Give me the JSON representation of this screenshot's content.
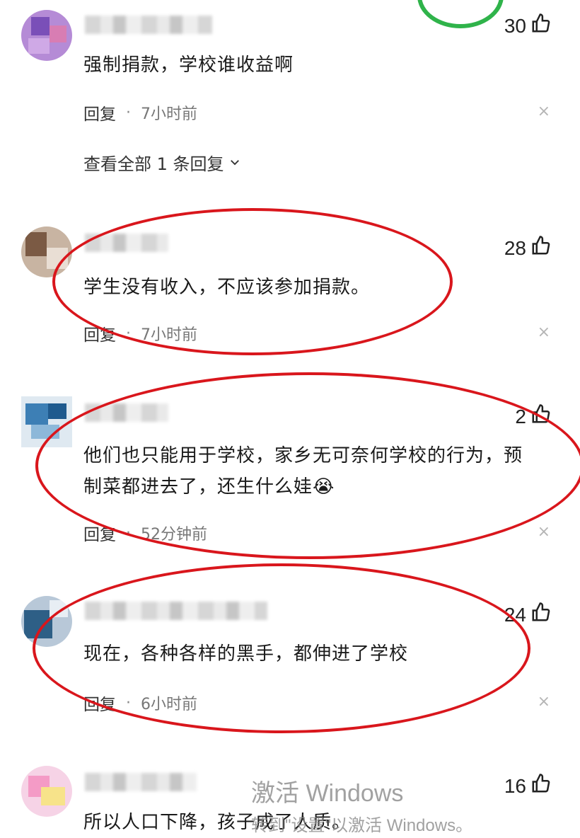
{
  "comments": [
    {
      "likes": "30",
      "text": "强制捐款，学校谁收益啊",
      "reply_label": "回复",
      "separator": "·",
      "time": "7小时前",
      "view_all": "查看全部 1 条回复"
    },
    {
      "likes": "28",
      "text": "学生没有收入，不应该参加捐款。",
      "reply_label": "回复",
      "separator": "·",
      "time": "7小时前"
    },
    {
      "likes": "2",
      "text_line1": "他们也只能用于学校，家乡无可奈何学校的行为，预",
      "text_line2": "制菜都进去了，还生什么娃",
      "emoji": "😭",
      "reply_label": "回复",
      "separator": "·",
      "time": "52分钟前"
    },
    {
      "likes": "24",
      "text": "现在，各种各样的黑手，都伸进了学校",
      "reply_label": "回复",
      "separator": "·",
      "time": "6小时前"
    },
    {
      "likes": "16",
      "text": "所以人口下降，孩子成了人质。"
    }
  ],
  "icons": {
    "like": "thumbs-up-icon",
    "close": "close-icon",
    "chevron": "chevron-down-icon"
  },
  "close_glyph": "×",
  "watermark": {
    "line1": "激活 Windows",
    "line2": "转到\"设置\"以激活 Windows。"
  },
  "colors": {
    "annotation_red": "#d9161c",
    "ring_green": "#2fb34a"
  }
}
